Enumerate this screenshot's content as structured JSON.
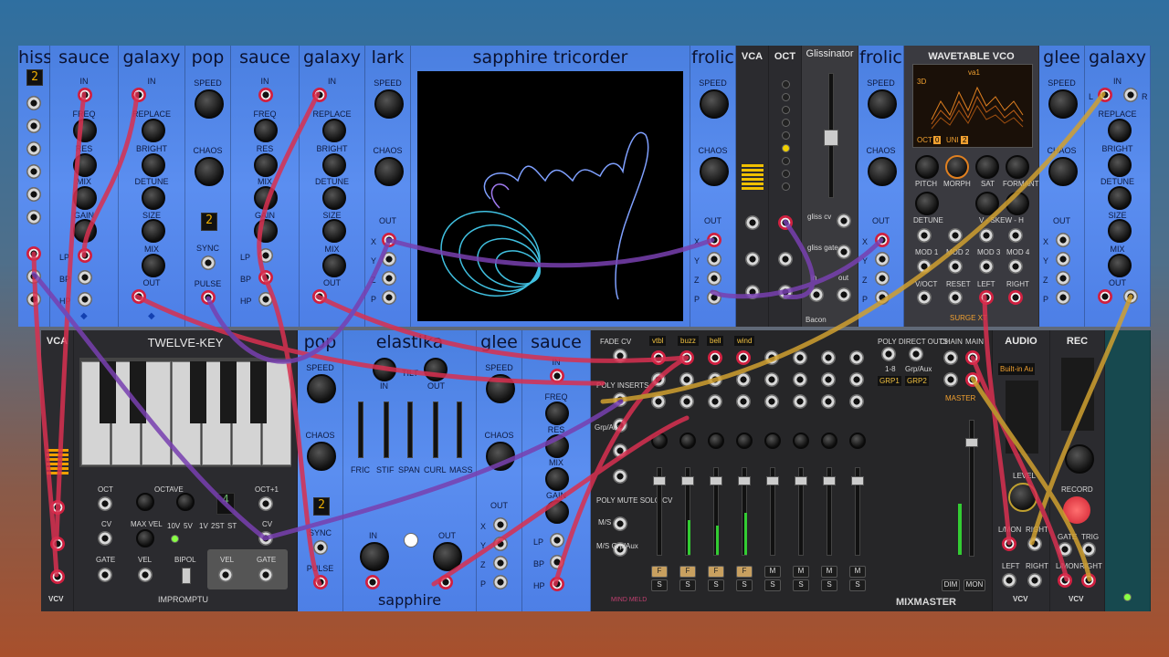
{
  "top_row": [
    {
      "title": "hiss",
      "display": "2",
      "labels": []
    },
    {
      "title": "sauce",
      "labels": [
        "IN",
        "FREQ",
        "RES",
        "MIX",
        "GAIN",
        "LP",
        "BP",
        "HP"
      ]
    },
    {
      "title": "galaxy",
      "labels": [
        "IN",
        "REPLACE",
        "BRIGHT",
        "DETUNE",
        "SIZE",
        "MIX",
        "OUT"
      ]
    },
    {
      "title": "pop",
      "labels": [
        "SPEED",
        "CHAOS",
        "SYNC",
        "PULSE"
      ],
      "display": "2"
    },
    {
      "title": "sauce",
      "labels": [
        "IN",
        "FREQ",
        "RES",
        "MIX",
        "GAIN",
        "LP",
        "BP",
        "HP"
      ]
    },
    {
      "title": "galaxy",
      "labels": [
        "IN",
        "REPLACE",
        "BRIGHT",
        "DETUNE",
        "SIZE",
        "MIX",
        "OUT"
      ]
    },
    {
      "title": "lark",
      "labels": [
        "SPEED",
        "CHAOS",
        "OUT",
        "X",
        "Y",
        "Z",
        "P"
      ]
    },
    {
      "title": "sapphire  tricorder"
    },
    {
      "title": "frolic",
      "labels": [
        "SPEED",
        "CHAOS",
        "OUT",
        "X",
        "Y",
        "Z",
        "P"
      ]
    },
    {
      "title": "VCA"
    },
    {
      "title": "OCT"
    },
    {
      "title": "Glissinator",
      "labels": [
        "gliss cv",
        "gliss gate",
        "in",
        "out"
      ],
      "brand": "Bacon"
    },
    {
      "title": "frolic",
      "labels": [
        "SPEED",
        "CHAOS",
        "OUT",
        "X",
        "Y",
        "Z",
        "P"
      ]
    },
    {
      "title": "WAVETABLE VCO",
      "labels": [
        "PITCH",
        "MORPH",
        "SAT",
        "FORMANT",
        "DETUNE",
        "V - SKEW - H",
        "MOD 1",
        "MOD 2",
        "MOD 3",
        "MOD 4",
        "V/OCT",
        "RESET",
        "LEFT",
        "RIGHT"
      ],
      "screen": {
        "name": "va1",
        "mode": "3D",
        "oct_label": "OCT",
        "oct_value": "0",
        "uni_label": "UNI",
        "uni_value": "2"
      },
      "brand": "SURGE XT"
    },
    {
      "title": "glee",
      "labels": [
        "SPEED",
        "CHAOS",
        "OUT",
        "X",
        "Y",
        "Z",
        "P"
      ]
    },
    {
      "title": "galaxy",
      "labels": [
        "IN",
        "REPLACE",
        "BRIGHT",
        "DETUNE",
        "SIZE",
        "MIX",
        "OUT",
        "L",
        "R"
      ]
    }
  ],
  "bottom_row": {
    "vca": {
      "title": "VCA",
      "brand": "VCV"
    },
    "keys": {
      "title": "TWELVE-KEY",
      "labels": [
        "OCT",
        "OCTAVE",
        "CV",
        "MAX VEL",
        "GATE",
        "VEL",
        "BIPOL",
        "VEL",
        "GATE",
        "OCT+1",
        "CV"
      ],
      "ranges": [
        "10V",
        "5V",
        "1V",
        "2ST",
        "ST"
      ],
      "display": "4",
      "brand": "IMPROMPTU"
    },
    "pop": {
      "title": "pop",
      "labels": [
        "SPEED",
        "CHAOS",
        "SYNC",
        "PULSE"
      ],
      "display": "2"
    },
    "elastika": {
      "title": "elastika",
      "labels": [
        "TILT",
        "IN",
        "OUT",
        "FRIC",
        "STIF",
        "SPAN",
        "CURL",
        "MASS",
        "IN",
        "OUT"
      ],
      "brand": "sapphire"
    },
    "glee": {
      "title": "glee",
      "labels": [
        "SPEED",
        "CHAOS",
        "OUT",
        "X",
        "Y",
        "Z",
        "P"
      ]
    },
    "sauce": {
      "title": "sauce",
      "labels": [
        "IN",
        "FREQ",
        "RES",
        "MIX",
        "GAIN",
        "LP",
        "BP",
        "HP"
      ]
    },
    "mixer": {
      "brand": "MIXMASTER",
      "maker": "MIND MELD",
      "left_labels": [
        "FADE CV",
        "POLY INSERTS",
        "Grp/Aux",
        "POLY MUTE SOLO CV",
        "M/S",
        "M/S Grp/Aux"
      ],
      "channels": [
        "vtbl",
        "buzz",
        "bell",
        "wind",
        "",
        "",
        "",
        "",
        "",
        ""
      ],
      "right_labels": [
        "POLY DIRECT OUTS",
        "1-8",
        "Grp/Aux",
        "GRP1",
        "GRP2",
        "CHAIN",
        "MAIN",
        "MASTER",
        "DIM",
        "MON"
      ],
      "fbtn": "F",
      "mbtn": "M",
      "sbtn": "S"
    },
    "audio": {
      "title": "AUDIO",
      "device": "Built-in Au",
      "labels": [
        "LEVEL",
        "L/MON",
        "RIGHT",
        "LEFT",
        "RIGHT"
      ],
      "brand": "VCV"
    },
    "rec": {
      "title": "REC",
      "labels": [
        "RECORD",
        "GATE",
        "TRIG",
        "L/MON",
        "RIGHT"
      ],
      "brand": "VCV"
    }
  },
  "colors": {
    "panel_blue": "#5b8ef0",
    "dark_panel": "#2b2b2f",
    "cable_red": "#d83050",
    "cable_purple": "#7840b0",
    "cable_yellow": "#d0a030"
  }
}
